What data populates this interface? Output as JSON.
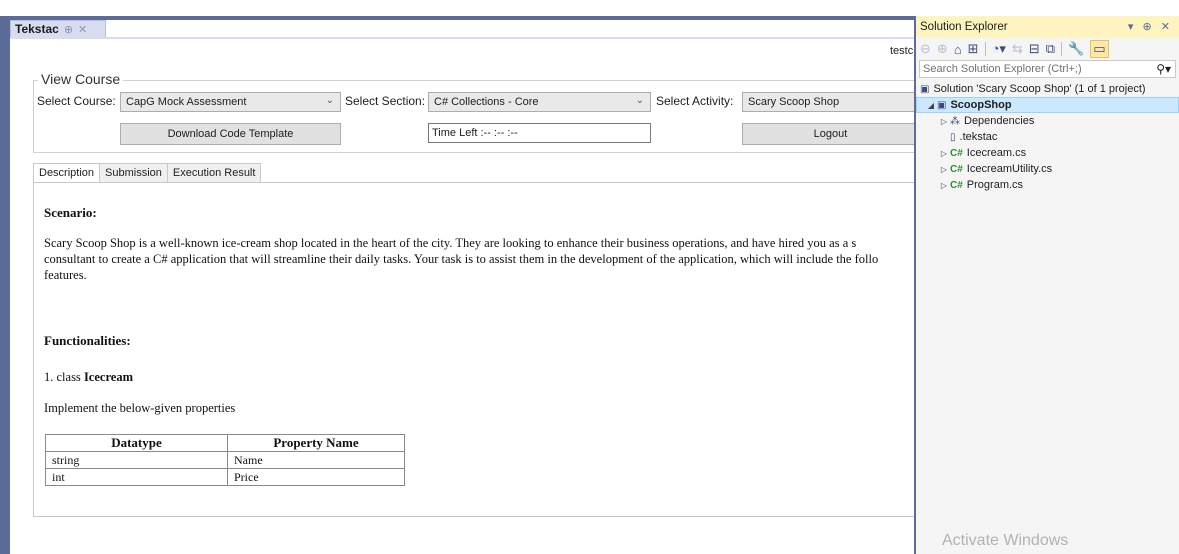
{
  "document_tab": {
    "title": "Tekstac",
    "pin": "⊕",
    "close": "✕"
  },
  "user_text": "testc",
  "view_course": {
    "group_title": "View Course",
    "select_course_label": "Select Course:",
    "course_value": "CapG Mock Assessment",
    "select_section_label": "Select Section:",
    "section_value": "C# Collections - Core",
    "select_activity_label": "Select Activity:",
    "activity_value": "Scary Scoop Shop",
    "download_button": "Download Code Template",
    "time_left": "Time Left  :-- :-- :--",
    "logout_button": "Logout"
  },
  "tabs": [
    "Description",
    "Submission",
    "Execution Result"
  ],
  "description": {
    "scenario_heading": "Scenario:",
    "scenario_lines": [
      "Scary Scoop Shop is a well-known ice-cream shop located in the heart of the city. They are looking to enhance their business operations, and have hired you as a s",
      "consultant to create a C# application that will streamline their daily tasks. Your task is to assist them in the development of the application, which will include the follo",
      "features."
    ],
    "functionalities_heading": "Functionalities:",
    "class_prefix": "1. class ",
    "class_name": "Icecream",
    "implement_text": "Implement the below-given properties",
    "table": {
      "headers": [
        "Datatype",
        "Property Name"
      ],
      "rows": [
        [
          "string",
          "Name"
        ],
        [
          "int",
          "Price"
        ]
      ]
    }
  },
  "solution_explorer": {
    "title": "Solution Explorer",
    "title_controls": "▾ ⊕ ✕",
    "search_placeholder": "Search Solution Explorer (Ctrl+;)",
    "solution_label": "Solution 'Scary Scoop Shop' (1 of 1 project)",
    "project_label": "ScoopShop",
    "items": [
      {
        "label": "Dependencies",
        "type": "dependencies"
      },
      {
        "label": ".tekstac",
        "type": "file"
      },
      {
        "label": "Icecream.cs",
        "type": "csharp"
      },
      {
        "label": "IcecreamUtility.cs",
        "type": "csharp"
      },
      {
        "label": "Program.cs",
        "type": "csharp"
      }
    ],
    "watermark": "Activate Windows"
  },
  "colors": {
    "frame": "#5d6b99",
    "se_title_bg": "#fdf4bf",
    "selection_bg": "#cce8ff",
    "csharp_green": "#388a34"
  }
}
